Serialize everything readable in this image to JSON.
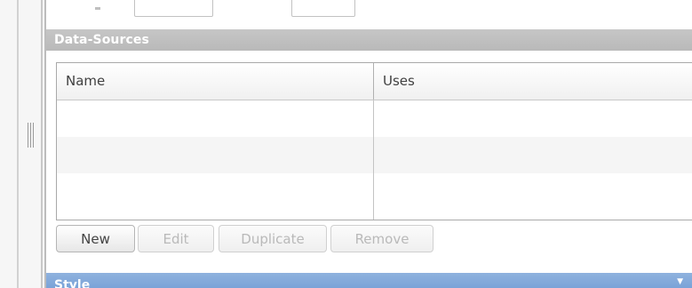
{
  "data_sources": {
    "header": "Data-Sources",
    "columns": {
      "name": "Name",
      "uses": "Uses"
    },
    "rows": [
      {
        "name": "",
        "uses": ""
      },
      {
        "name": "",
        "uses": ""
      },
      {
        "name": "",
        "uses": ""
      }
    ]
  },
  "buttons": {
    "new": "New",
    "edit": "Edit",
    "duplicate": "Duplicate",
    "remove": "Remove"
  },
  "style_section": {
    "header": "Style",
    "toggle_icon": "chevron-down-icon"
  }
}
